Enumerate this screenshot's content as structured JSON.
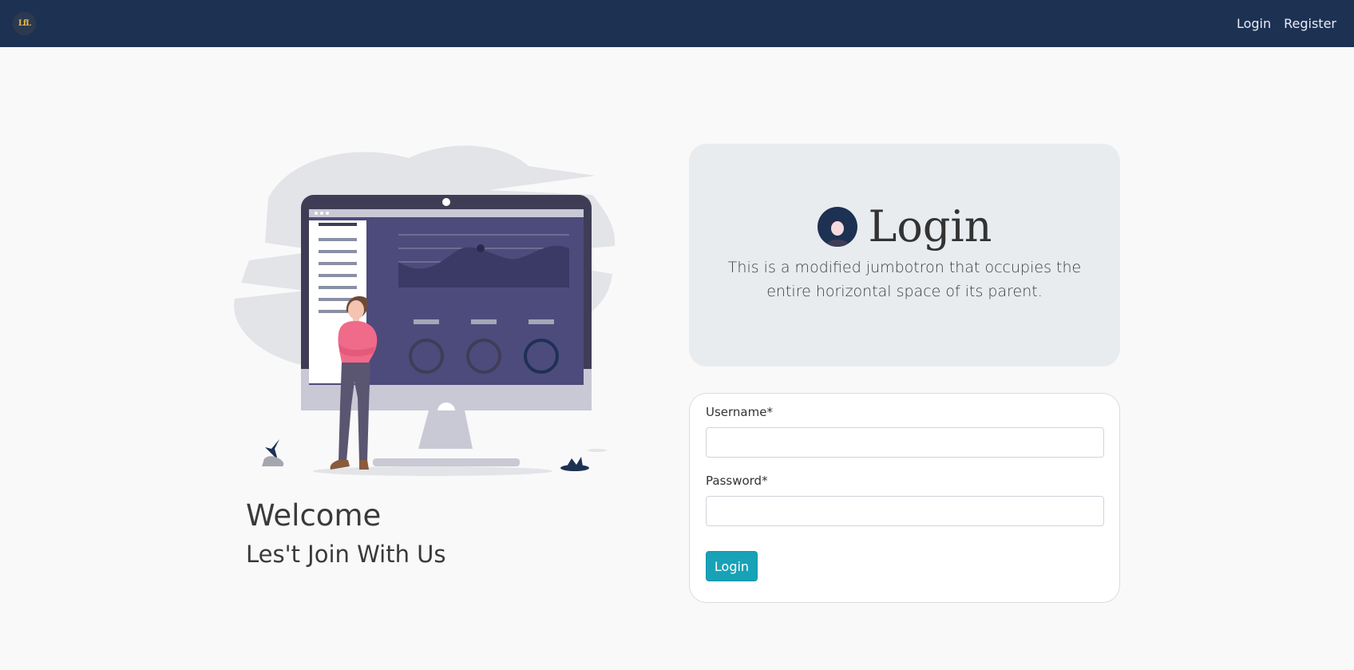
{
  "navbar": {
    "brand_text": "LfL",
    "links": [
      {
        "label": "Login"
      },
      {
        "label": "Register"
      }
    ]
  },
  "welcome": {
    "title": "Welcome",
    "subtitle": "Les't Join With Us"
  },
  "jumbotron": {
    "title": "Login",
    "text": "This is a modified jumbotron that occupies the entire horizontal space of its parent."
  },
  "form": {
    "username_label": "Username*",
    "username_value": "",
    "password_label": "Password*",
    "password_value": "",
    "submit_label": "Login"
  },
  "colors": {
    "navbar": "#1d3153",
    "accent": "#17a2b8",
    "person_shirt": "#f06a8a",
    "screen": "#4d4b7c"
  }
}
